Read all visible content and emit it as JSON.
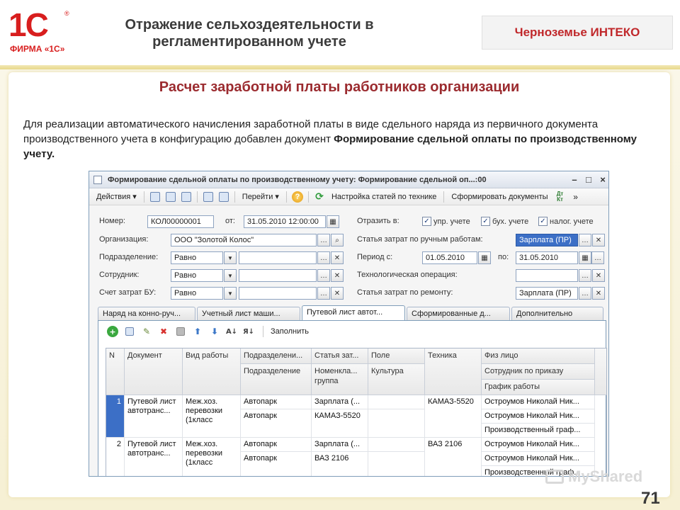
{
  "logo": {
    "mark": "1С",
    "reg": "®",
    "firm": "ФИРМА «1С»"
  },
  "header": {
    "title": "Отражение сельхоздеятельности в регламентированном учете",
    "brand": "Черноземье ИНТЕКО"
  },
  "slide": {
    "subtitle": "Расчет заработной платы работников организации",
    "desc_plain": "Для реализации автоматического начисления заработной платы в виде сдельного наряда из первичного документа производственного учета в конфигурацию добавлен документ ",
    "desc_bold": "Формирование сдельной оплаты по производственному учету.",
    "page": "71",
    "watermark": "MyShared"
  },
  "window": {
    "title": "Формирование сдельной оплаты по производственному учету: Формирование сдельной оп...:00",
    "toolbar": {
      "actions": "Действия",
      "goto": "Перейти",
      "setup": "Настройка статей по технике",
      "form_docs": "Сформировать документы",
      "dtkt_top": "Дт",
      "dtkt_bot": "Кт"
    },
    "form": {
      "number_label": "Номер:",
      "number_value": "КОЛ00000001",
      "date_label": "от:",
      "date_value": "31.05.2010 12:00:00",
      "reflect_label": "Отразить в:",
      "chk_upr": "упр. учете",
      "chk_buh": "бух. учете",
      "chk_nal": "налог. учете",
      "org_label": "Организация:",
      "org_value": "ООО \"Золотой Колос\"",
      "cost_manual_label": "Статья затрат по ручным работам:",
      "cost_manual_value": "Зарплата (ПР)",
      "dept_label": "Подразделение:",
      "dept_cond": "Равно",
      "period_label": "Период с:",
      "period_from": "01.05.2010",
      "period_to_label": "по:",
      "period_to": "31.05.2010",
      "emp_label": "Сотрудник:",
      "emp_cond": "Равно",
      "tech_op_label": "Технологическая операция:",
      "account_label": "Счет затрат БУ:",
      "account_cond": "Равно",
      "cost_repair_label": "Статья затрат по ремонту:",
      "cost_repair_value": "Зарплата (ПР)"
    },
    "tabs": [
      {
        "label": "Наряд на конно-руч..."
      },
      {
        "label": "Учетный лист маши..."
      },
      {
        "label": "Путевой лист автот..."
      },
      {
        "label": "Сформированные д..."
      },
      {
        "label": "Дополнительно"
      }
    ],
    "subbar": {
      "fill": "Заполнить"
    },
    "grid": {
      "headers": {
        "n": "N",
        "doc": "Документ",
        "work": "Вид работы",
        "dept1": "Подразделени...",
        "dept2": "Подразделение",
        "cost1": "Статья зат...",
        "cost2": "Номенкла... группа",
        "field1": "Поле",
        "field2": "Культура",
        "tech": "Техника",
        "person1": "Физ лицо",
        "person2": "Сотрудник по приказу",
        "person3": "График работы"
      },
      "rows": [
        {
          "n": "1",
          "doc": "Путевой лист автотранс...",
          "work": "Меж.хоз. перевозки (1класс",
          "dept1": "Автопарк",
          "dept2": "Автопарк",
          "cost1": "Зарплата (...",
          "cost2": "КАМАЗ-5520",
          "tech": "КАМАЗ-5520",
          "person1": "Остроумов Николай Ник...",
          "person2": "Остроумов Николай Ник...",
          "person3": "Производственный граф..."
        },
        {
          "n": "2",
          "doc": "Путевой лист автотранс...",
          "work": "Меж.хоз. перевозки (1класс",
          "dept1": "Автопарк",
          "dept2": "Автопарк",
          "cost1": "Зарплата (...",
          "cost2": "ВАЗ 2106",
          "tech": "ВАЗ 2106",
          "person1": "Остроумов Николай Ник...",
          "person2": "Остроумов Николай Ник...",
          "person3": "Производственный граф..."
        }
      ]
    }
  }
}
